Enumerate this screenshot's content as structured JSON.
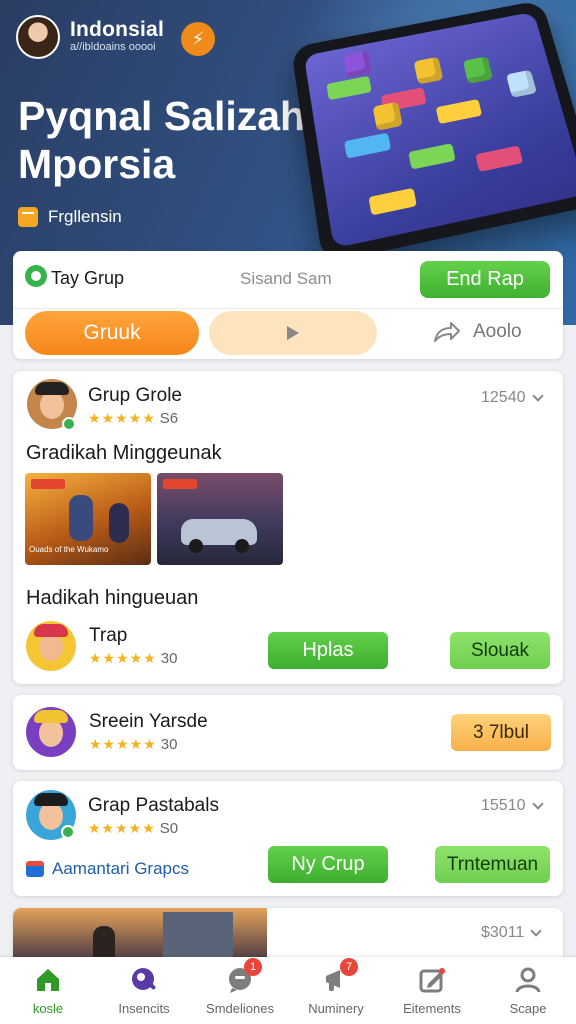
{
  "header": {
    "app_title": "Indonsial",
    "app_subtitle": "a//ibldoains ooooi",
    "hero_title": "Pyqnal Salizah Mporsia",
    "tag_label": "Frɡllensin",
    "icons": {
      "avatar": "profile-avatar",
      "brand": "brand-badge-icon",
      "more": "more-vert-icon",
      "tag": "tag-icon"
    }
  },
  "action_card": {
    "group_label": "Tay Grup",
    "center_text": "Sisand Sam",
    "primary_button": "End Rap",
    "pill_button": "Gruuk",
    "share_label": "Aoolo"
  },
  "cards": [
    {
      "name": "Grup Grole",
      "stars": "★★★★★",
      "rating": "S6",
      "meta": "12540",
      "section_title": "Gradikah Minggeunak",
      "thumbs": [
        {
          "caption": "Ouads of the Wukamo"
        },
        {
          "caption": ""
        }
      ],
      "sub_section_title": "Hadikah  hingueuan",
      "sub": {
        "name": "Trap",
        "stars": "★★★★★",
        "rating": "30",
        "button_a": "Hplas",
        "button_b": "Slouak"
      }
    },
    {
      "name": "Sreein Yarsde",
      "stars": "★★★★★",
      "rating": "30",
      "button": "3 7lbul"
    },
    {
      "name": "Grap Pastabals",
      "stars": "★★★★★",
      "rating": "S0",
      "meta": "15510",
      "link": "Aamantari Grapcs",
      "button_a": "Ny Crup",
      "button_b": "Trntemuan"
    },
    {
      "meta": "$3011"
    }
  ],
  "bottom_nav": [
    {
      "label": "kosle",
      "icon": "home-icon",
      "active": true
    },
    {
      "label": "Insencits",
      "icon": "insights-icon"
    },
    {
      "label": "Smdeliones",
      "icon": "chat-icon",
      "badge": "1"
    },
    {
      "label": "Numinery",
      "icon": "announce-icon",
      "badge": "7"
    },
    {
      "label": "Eitements",
      "icon": "edit-icon"
    },
    {
      "label": "Scape",
      "icon": "profile-icon"
    }
  ],
  "colors": {
    "accent_green": "#3fb02f",
    "accent_orange": "#f5861a",
    "hero_blue": "#2f4f7f"
  }
}
